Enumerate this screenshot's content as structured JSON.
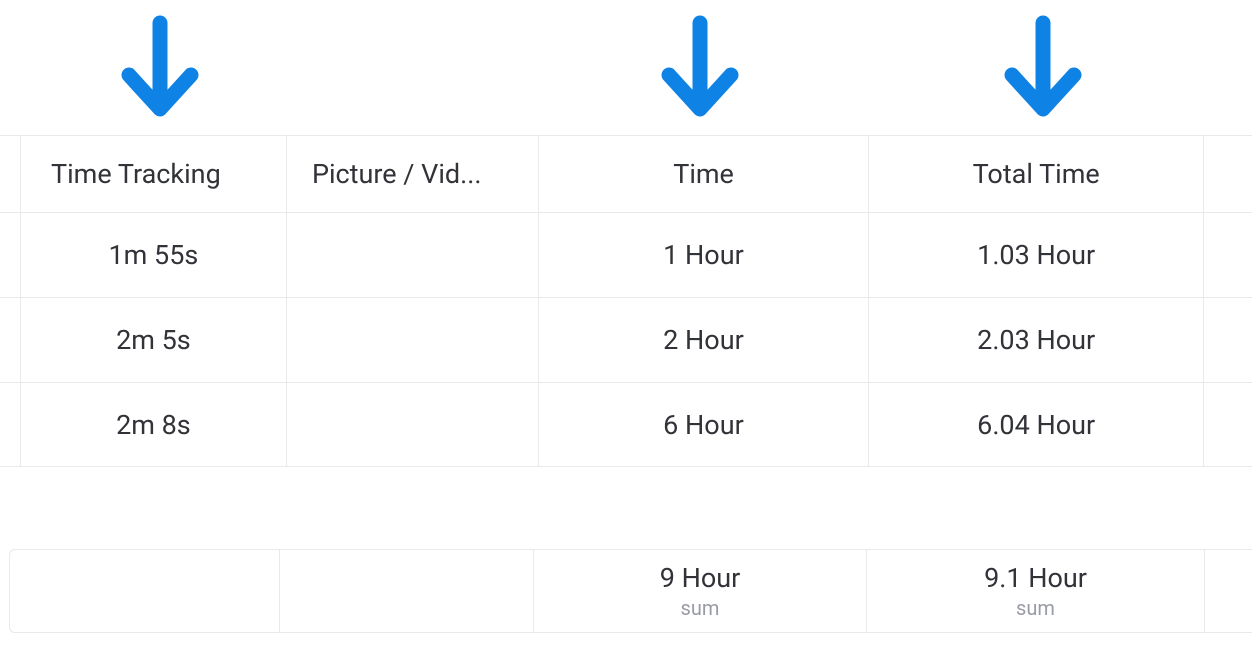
{
  "arrow_color": "#0f82e6",
  "columns": {
    "time_tracking": "Time Tracking",
    "picture_video": "Picture / Vid...",
    "time": "Time",
    "total_time": "Total Time"
  },
  "rows": [
    {
      "time_tracking": "1m 55s",
      "picture_video": "",
      "time": "1 Hour",
      "total_time": "1.03 Hour"
    },
    {
      "time_tracking": "2m 5s",
      "picture_video": "",
      "time": "2 Hour",
      "total_time": "2.03 Hour"
    },
    {
      "time_tracking": "2m 8s",
      "picture_video": "",
      "time": "6 Hour",
      "total_time": "6.04 Hour"
    }
  ],
  "summary": {
    "time": {
      "value": "9 Hour",
      "label": "sum"
    },
    "total_time": {
      "value": "9.1 Hour",
      "label": "sum"
    }
  }
}
